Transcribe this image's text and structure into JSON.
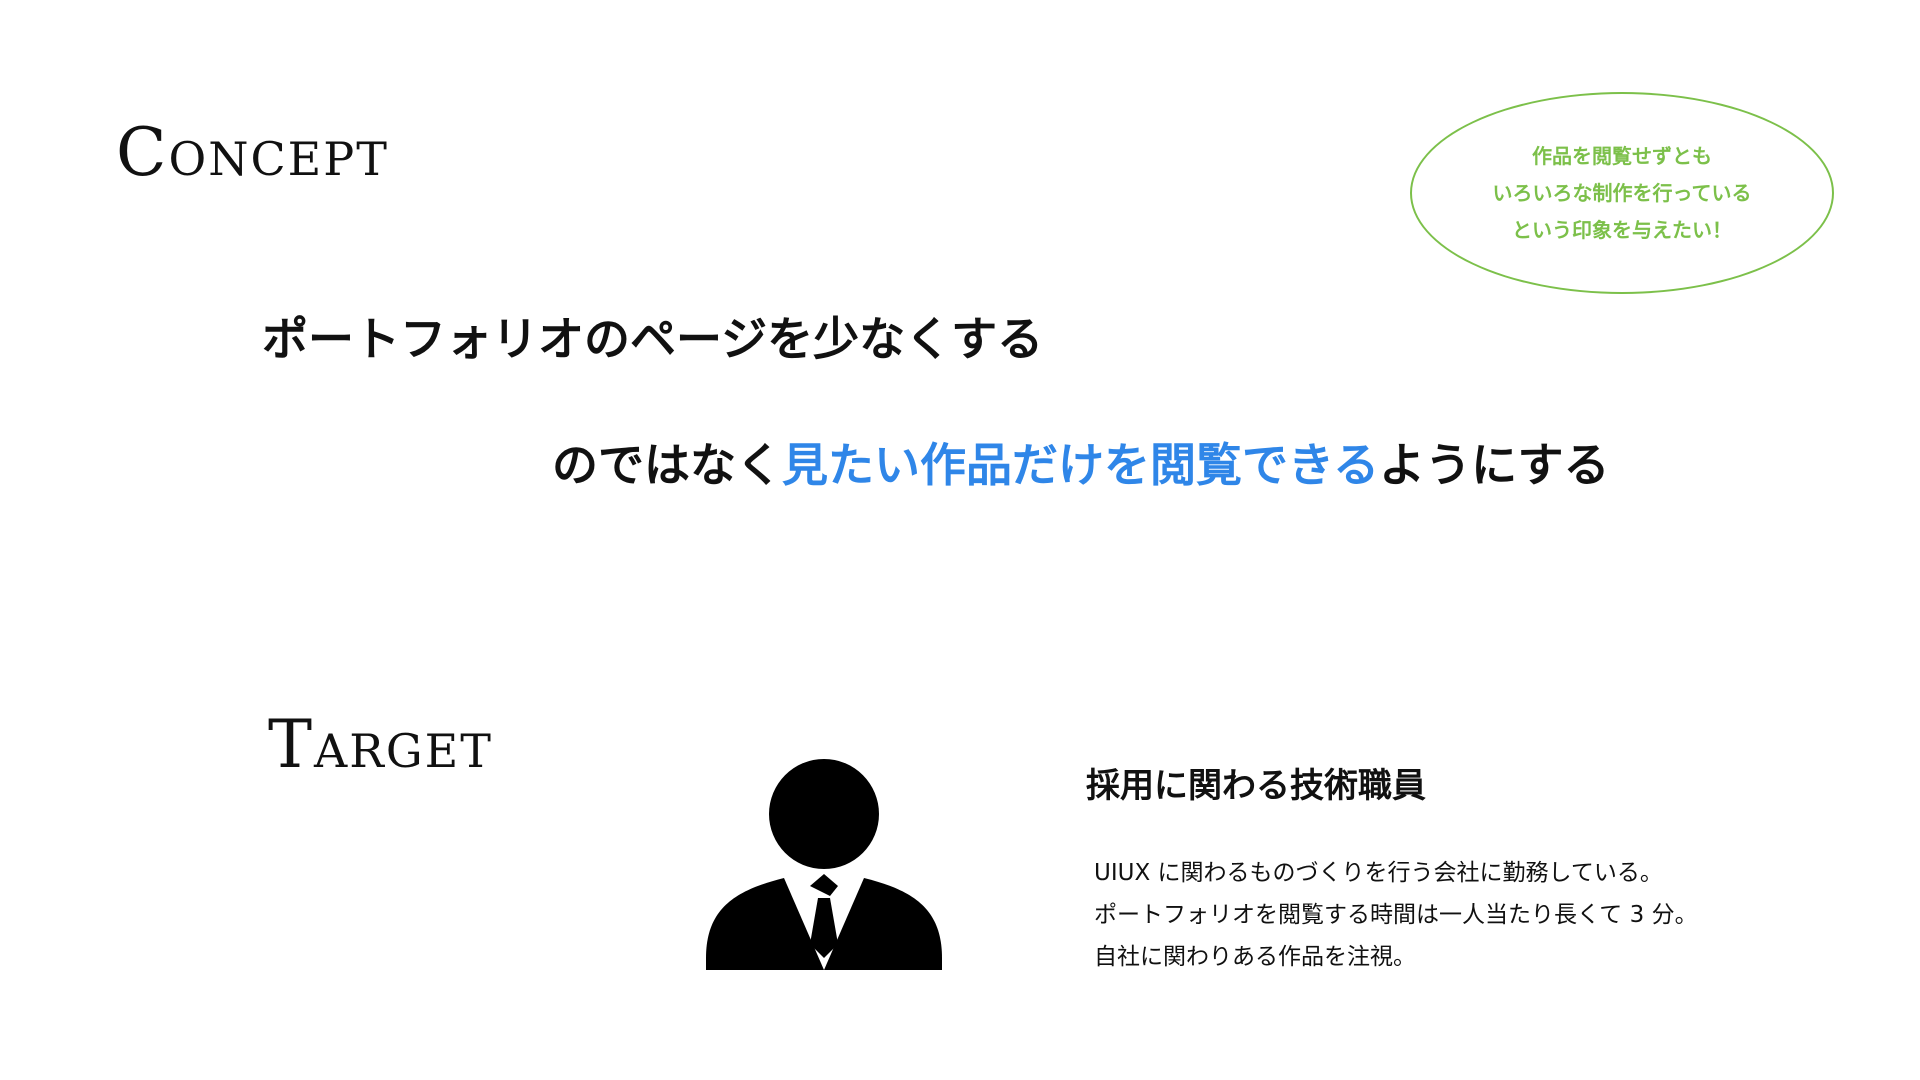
{
  "concept": {
    "heading": "Concept",
    "bubble_lines": [
      "作品を閲覧せずとも",
      "いろいろな制作を行っている",
      "という印象を与えたい！"
    ],
    "line_1": "ポートフォリオのページを少なくする",
    "line_2_prefix": "のではなく",
    "line_2_highlight": "見たい作品だけを閲覧できる",
    "line_2_suffix": "ようにする",
    "highlight_color": "#2f86e8",
    "bubble_color": "#7cc04a"
  },
  "target": {
    "heading": "Target",
    "icon": "businessman-icon",
    "title": "採用に関わる技術職員",
    "description_lines": [
      "UIUX に関わるものづくりを行う会社に勤務している。",
      "ポートフォリオを閲覧する時間は一人当たり長くて 3 分。",
      "自社に関わりある作品を注視。"
    ]
  }
}
